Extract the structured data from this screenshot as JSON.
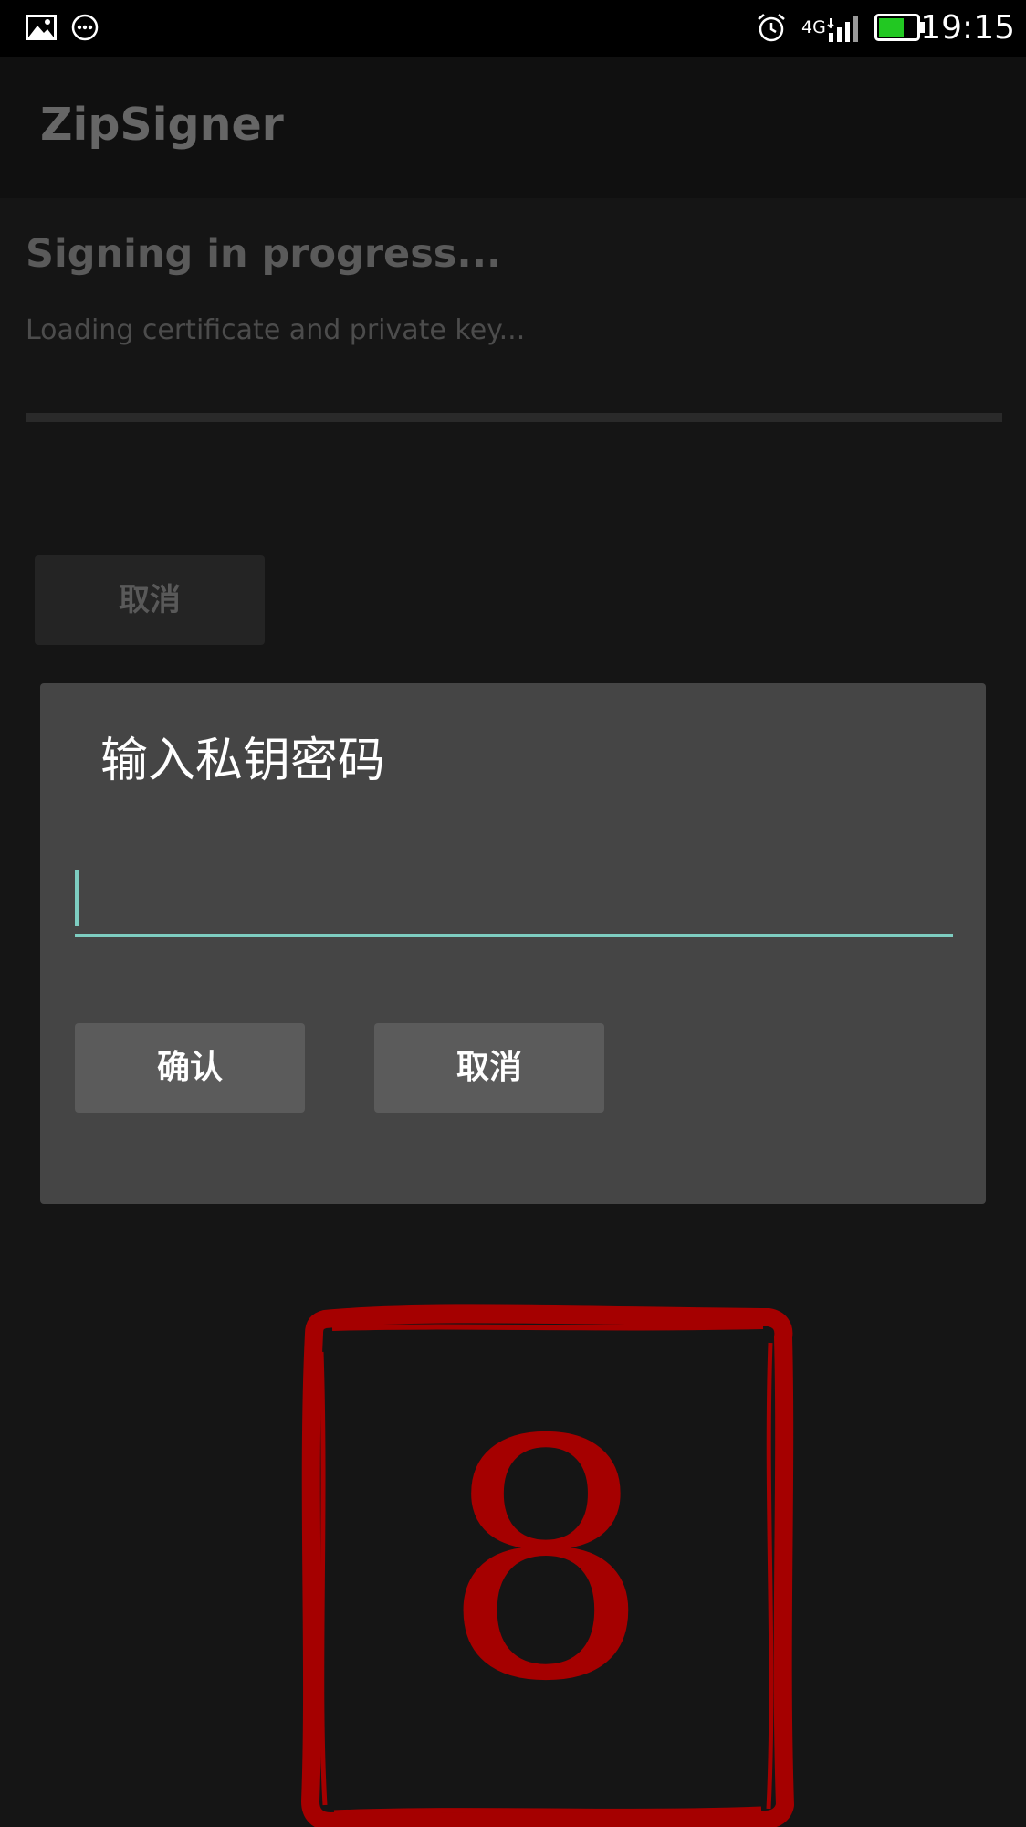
{
  "status_bar": {
    "left_icons": [
      "image-icon",
      "more-dots-icon"
    ],
    "right_icons": [
      "alarm-icon",
      "signal-icon",
      "battery-icon"
    ],
    "network": "4G",
    "time": "19:15",
    "battery_color": "#22c822"
  },
  "app_bar": {
    "title": "ZipSigner"
  },
  "progress": {
    "heading": "Signing in progress...",
    "message": "Loading certificate and private key...",
    "value": 0,
    "cancel_label": "取消"
  },
  "dialog": {
    "title": "输入私钥密码",
    "password_value": "",
    "confirm_label": "确认",
    "cancel_label": "取消",
    "accent_color": "#7ecdc1"
  },
  "stamp": {
    "number": "8",
    "color": "#a50000"
  }
}
